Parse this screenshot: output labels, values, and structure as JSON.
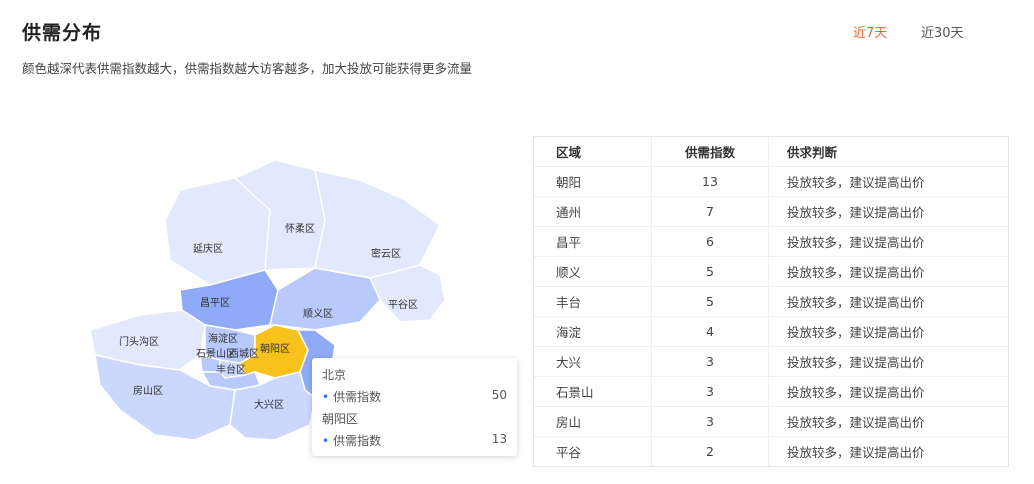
{
  "header": {
    "title": "供需分布",
    "subtitle": "颜色越深代表供需指数越大，供需指数越大访客越多，加大投放可能获得更多流量",
    "tabs": [
      {
        "label": "近7天",
        "active": true
      },
      {
        "label": "近30天",
        "active": false
      }
    ]
  },
  "colors": {
    "accent": "#f06a2d",
    "highlight": "#f6c21b",
    "dark_region": "#8faaf6",
    "mid_region": "#b9c9fb",
    "light_region": "#e3e9fd"
  },
  "map": {
    "labels": {
      "huairou": "怀柔区",
      "yanqing": "延庆区",
      "miyun": "密云区",
      "changping": "昌平区",
      "shunyi": "顺义区",
      "pinggu": "平谷区",
      "mentougou": "门头沟区",
      "haidian": "海淀区",
      "shijingshan": "石景山区",
      "xicheng": "西城区",
      "chaoyang": "朝阳区",
      "fengtai": "丰台区",
      "fangshan": "房山区",
      "daxing": "大兴区"
    },
    "tooltip": {
      "city": "北京",
      "city_metric_label": "供需指数",
      "city_metric_value": "50",
      "district": "朝阳区",
      "district_metric_label": "供需指数",
      "district_metric_value": "13"
    }
  },
  "table": {
    "headers": [
      "区域",
      "供需指数",
      "供求判断"
    ],
    "rows": [
      {
        "area": "朝阳",
        "index": "13",
        "judgment": "投放较多，建议提高出价"
      },
      {
        "area": "通州",
        "index": "7",
        "judgment": "投放较多，建议提高出价"
      },
      {
        "area": "昌平",
        "index": "6",
        "judgment": "投放较多，建议提高出价"
      },
      {
        "area": "顺义",
        "index": "5",
        "judgment": "投放较多，建议提高出价"
      },
      {
        "area": "丰台",
        "index": "5",
        "judgment": "投放较多，建议提高出价"
      },
      {
        "area": "海淀",
        "index": "4",
        "judgment": "投放较多，建议提高出价"
      },
      {
        "area": "大兴",
        "index": "3",
        "judgment": "投放较多，建议提高出价"
      },
      {
        "area": "石景山",
        "index": "3",
        "judgment": "投放较多，建议提高出价"
      },
      {
        "area": "房山",
        "index": "3",
        "judgment": "投放较多，建议提高出价"
      },
      {
        "area": "平谷",
        "index": "2",
        "judgment": "投放较多，建议提高出价"
      }
    ]
  }
}
